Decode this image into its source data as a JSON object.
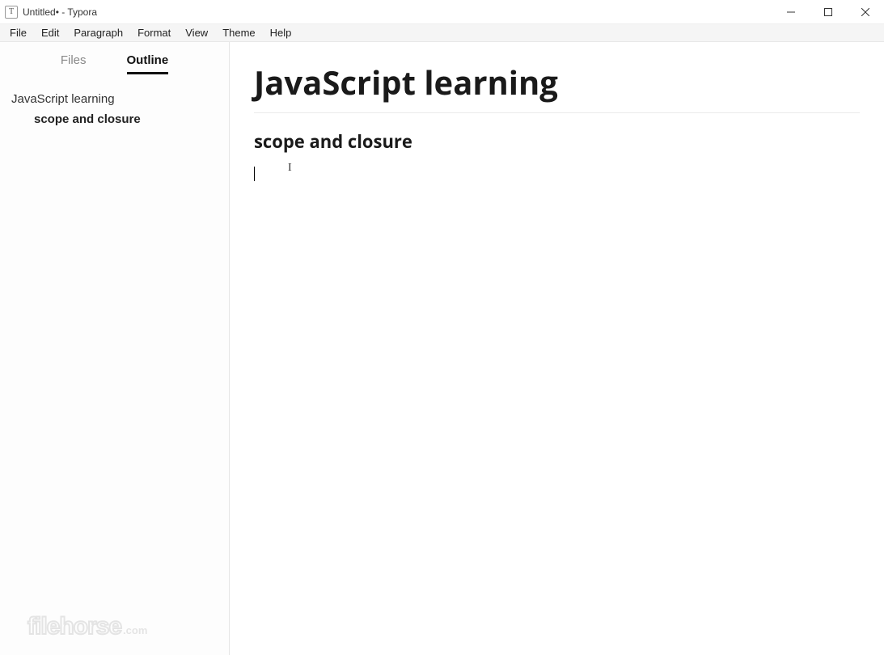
{
  "window": {
    "title": "Untitled• - Typora"
  },
  "menubar": {
    "items": [
      "File",
      "Edit",
      "Paragraph",
      "Format",
      "View",
      "Theme",
      "Help"
    ]
  },
  "sidebar": {
    "tabs": {
      "files": "Files",
      "outline": "Outline"
    },
    "activeTab": "outline",
    "outline": [
      {
        "level": 1,
        "text": "JavaScript learning"
      },
      {
        "level": 2,
        "text": "scope and closure"
      }
    ]
  },
  "document": {
    "h1": "JavaScript learning",
    "h2": "scope and closure"
  },
  "watermark": {
    "main": "filehorse",
    "domain": ".com"
  }
}
